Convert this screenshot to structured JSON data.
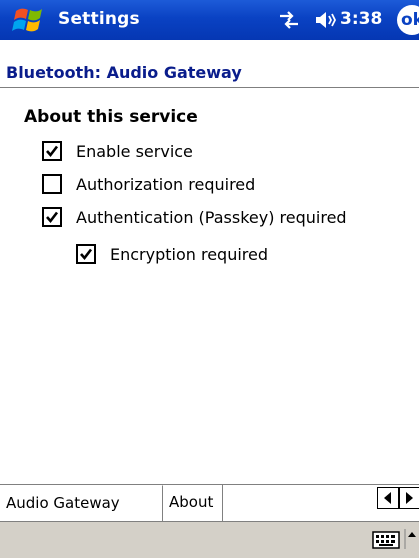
{
  "titlebar": {
    "app_title": "Settings",
    "clock": "3:38",
    "ok_label": "ok",
    "icons": [
      "windows-flag-icon",
      "connectivity-icon",
      "volume-icon"
    ]
  },
  "page": {
    "title": "Bluetooth: Audio Gateway",
    "section_heading": "About this service"
  },
  "options": [
    {
      "label": "Enable service",
      "checked": true
    },
    {
      "label": "Authorization required",
      "checked": false
    },
    {
      "label": "Authentication (Passkey) required",
      "checked": true
    },
    {
      "label": "Encryption required",
      "checked": true
    }
  ],
  "tabs": [
    {
      "label": "Audio Gateway",
      "selected": true
    },
    {
      "label": "About",
      "selected": false
    }
  ],
  "menu_bar": {
    "icons": [
      "keyboard-icon",
      "input-panel-arrow-icon"
    ]
  },
  "colors": {
    "titlebar_blue": "#0a42c3",
    "header_text": "#0a1d8c",
    "menu_bar_gray": "#d4d0c8"
  }
}
